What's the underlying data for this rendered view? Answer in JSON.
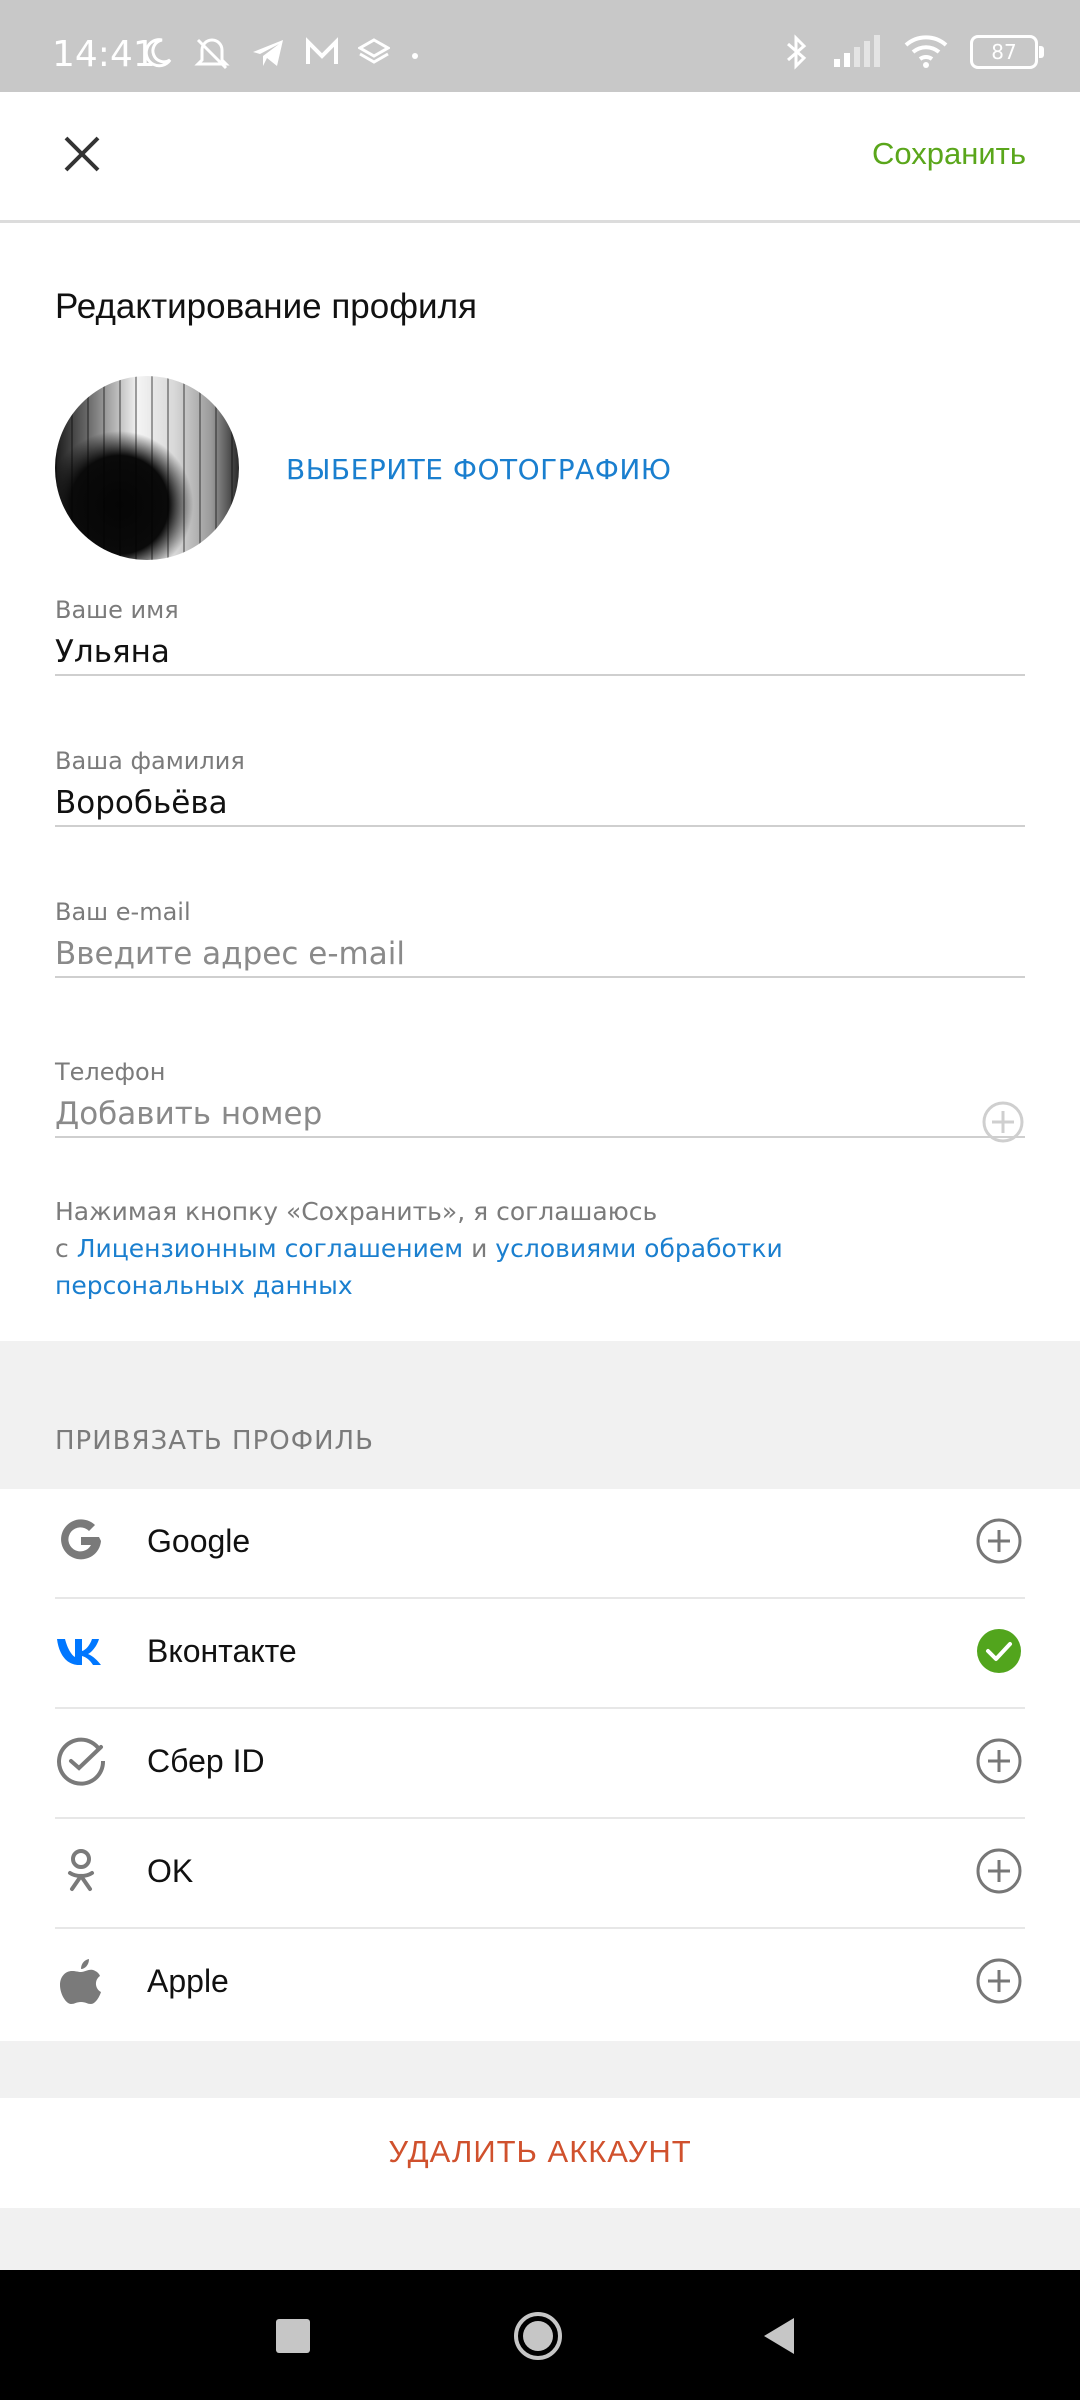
{
  "status_bar": {
    "time": "14:41",
    "battery": "87",
    "icons_left": [
      "moon-icon",
      "mute-icon",
      "telegram-icon",
      "mail-icon",
      "layers-icon",
      "dot-icon"
    ],
    "icons_right": [
      "bluetooth-icon",
      "signal-icon",
      "wifi-icon",
      "battery-icon"
    ]
  },
  "toolbar": {
    "close_icon": "close-icon",
    "save_label": "Сохранить"
  },
  "profile": {
    "title": "Редактирование профиля",
    "choose_photo": "ВЫБЕРИТЕ ФОТОГРАФИЮ",
    "fields": {
      "first_name": {
        "label": "Ваше имя",
        "value": "Ульяна"
      },
      "last_name": {
        "label": "Ваша фамилия",
        "value": "Воробьёва"
      },
      "email": {
        "label": "Ваш e-mail",
        "placeholder": "Введите адрес e-mail"
      },
      "phone": {
        "label": "Телефон",
        "placeholder": "Добавить номер"
      }
    },
    "consent": {
      "prefix": "Нажимая кнопку «Сохранить», я соглашаюсь",
      "c": "с",
      "license_link": "Лицензионным соглашением",
      "and": "и",
      "terms_link_part1": "условиями обработки",
      "terms_link_part2": "персональных данных"
    }
  },
  "linking": {
    "header": "ПРИВЯЗАТЬ ПРОФИЛЬ",
    "providers": [
      {
        "name": "Google",
        "icon": "google-icon",
        "status": "add",
        "status_icon": "plus-circle-icon"
      },
      {
        "name": "Вконтакте",
        "icon": "vk-icon",
        "status": "linked",
        "status_icon": "check-circle-icon"
      },
      {
        "name": "Сбер ID",
        "icon": "sber-icon",
        "status": "add",
        "status_icon": "plus-circle-icon"
      },
      {
        "name": "OK",
        "icon": "odnoklassniki-icon",
        "status": "add",
        "status_icon": "plus-circle-icon"
      },
      {
        "name": "Apple",
        "icon": "apple-icon",
        "status": "add",
        "status_icon": "plus-circle-icon"
      }
    ]
  },
  "danger": {
    "delete_label": "УДАЛИТЬ АККАУНТ"
  },
  "colors": {
    "save_green": "#5aa61b",
    "link_blue": "#1a7fcf",
    "delete_red": "#d0512d",
    "check_green": "#52a51d",
    "vk_blue": "#0077ff"
  },
  "navbar": {
    "icons": [
      "recent-apps-icon",
      "home-icon",
      "back-icon"
    ]
  }
}
